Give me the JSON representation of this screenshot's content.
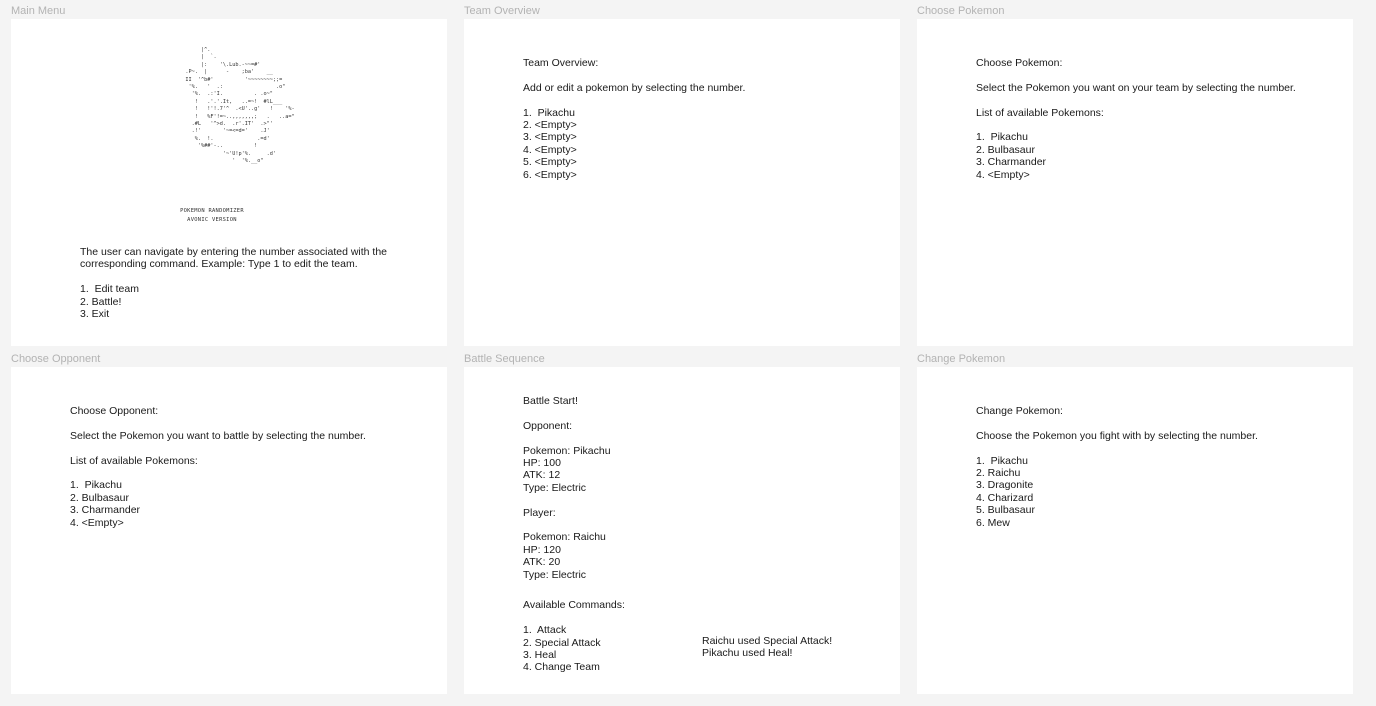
{
  "frames": {
    "main_menu": {
      "label": "Main Menu",
      "ascii_art": "        |^.\n        |  `.\n        |:    '\\.Lub.-~~=#'\n   .P~.  |      -    ;ba'    __\n   II  '^b#'          '~~~~~~~~;;=\n    '%.   '  .:                 .o\"\n     '%.  .:'I.          . .o~\"\n      !   .'.'.It,   ..=~!  #lL___\n      !   !'!.7'^  .<U'..g'   !    '%-\n      !   %F'!=~..,,,,,,,;   .   ..a=\"\n     .#L   '^>d.  .r'.IT'  .>\"'\n     .!'       '~=<=d='    .J'\n      %.  !.              .=d'\n       '%##'-..          !\n               '~'U!p'%.     .d'\n                  '  '%.__o\"",
      "logo_line1": "POKEMON RANDOMIZER",
      "logo_line2": "AVONIC VERSION",
      "instructions_line1": "The user can navigate by entering the number associated with the",
      "instructions_line2": "corresponding command. Example: Type 1 to edit the team.",
      "options": [
        "1.  Edit team",
        "2. Battle!",
        "3. Exit"
      ]
    },
    "team_overview": {
      "label": "Team Overview",
      "heading": "Team Overview:",
      "instruction": "Add or edit a pokemon by selecting the number.",
      "options": [
        "1.  Pikachu",
        "2. <Empty>",
        "3. <Empty>",
        "4. <Empty>",
        "5. <Empty>",
        "6. <Empty>"
      ]
    },
    "choose_pokemon": {
      "label": "Choose Pokemon",
      "heading": "Choose Pokemon:",
      "instruction": "Select the Pokemon you want on your team by selecting the number.",
      "list_heading": "List of available Pokemons:",
      "options": [
        "1.  Pikachu",
        "2. Bulbasaur",
        "3. Charmander",
        "4. <Empty>"
      ]
    },
    "choose_opponent": {
      "label": "Choose Opponent",
      "heading": "Choose Opponent:",
      "instruction": "Select the Pokemon you want to battle by selecting the number.",
      "list_heading": "List of available Pokemons:",
      "options": [
        "1.  Pikachu",
        "2. Bulbasaur",
        "3. Charmander",
        "4. <Empty>"
      ]
    },
    "battle_sequence": {
      "label": "Battle Sequence",
      "heading": "Battle Start!",
      "opponent_label": "Opponent:",
      "opponent_stats": [
        "Pokemon: Pikachu",
        "HP: 100",
        "ATK: 12",
        "Type: Electric"
      ],
      "player_label": "Player:",
      "player_stats": [
        "Pokemon: Raichu",
        "HP: 120",
        "ATK: 20",
        "Type: Electric"
      ],
      "commands_label": "Available Commands:",
      "commands": [
        "1.  Attack",
        "2. Special Attack",
        "3. Heal",
        "4. Change Team"
      ],
      "log": [
        "Raichu used Special Attack!",
        "Pikachu used Heal!"
      ]
    },
    "change_pokemon": {
      "label": "Change Pokemon",
      "heading": "Change Pokemon:",
      "instruction": "Choose the Pokemon you fight with by selecting the number.",
      "options": [
        "1.  Pikachu",
        "2. Raichu",
        "3. Dragonite",
        "4. Charizard",
        "5. Bulbasaur",
        "6. Mew"
      ]
    }
  }
}
